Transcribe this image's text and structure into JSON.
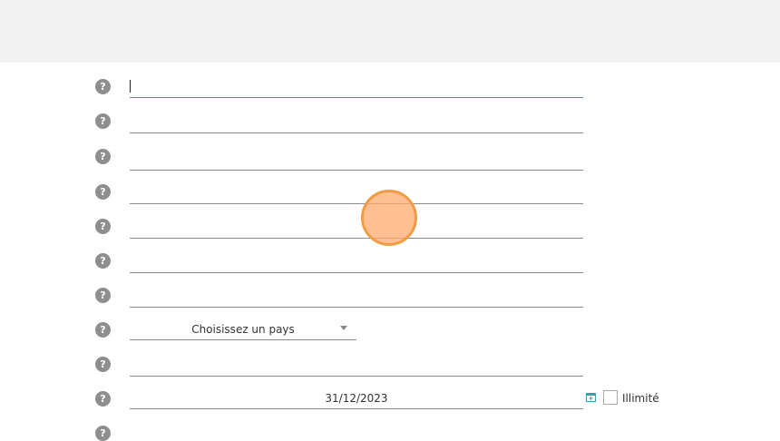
{
  "help_icon_glyph": "?",
  "form": {
    "country_select": {
      "selected": "Choisissez un pays"
    },
    "date_field": {
      "value": "31/12/2023"
    },
    "unlimited_checkbox": {
      "label": "Illimité",
      "checked": false
    }
  },
  "colors": {
    "topbar": "#f2f2f2",
    "help_icon": "#8e8e8e",
    "focus_underline": "#3aa0a8",
    "touch_indicator": "#f29b45",
    "calendar_icon": "#3aa0a8"
  }
}
